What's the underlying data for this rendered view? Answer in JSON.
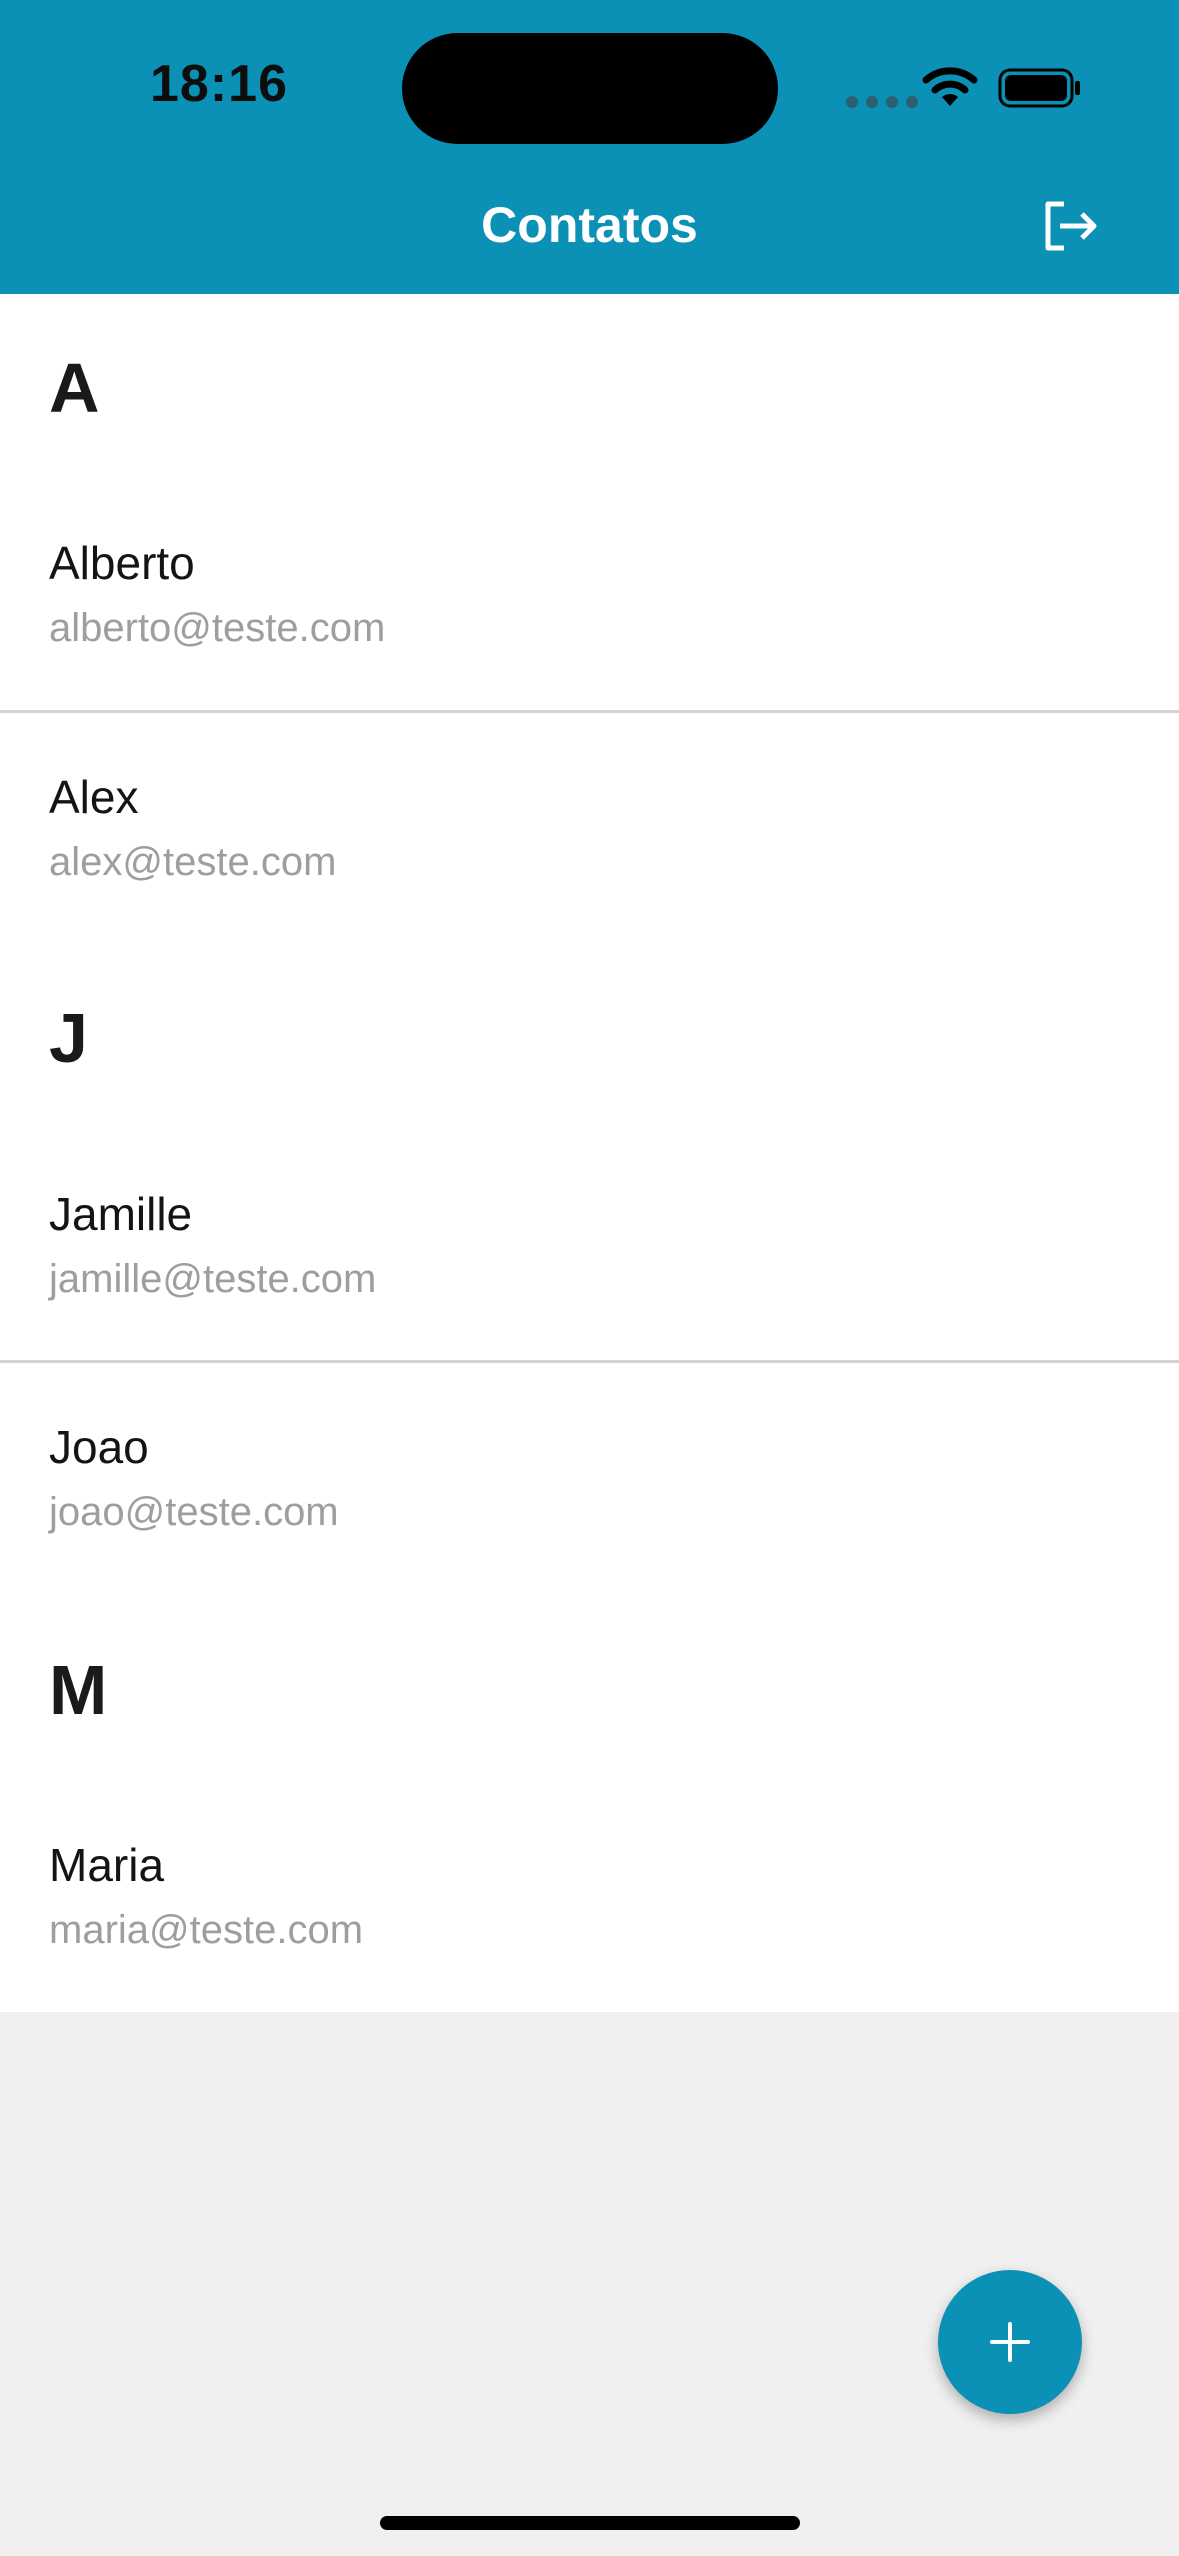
{
  "status_bar": {
    "time": "18:16"
  },
  "header": {
    "title": "Contatos",
    "logout_icon": "logout-icon"
  },
  "sections": [
    {
      "letter": "A",
      "contacts": [
        {
          "name": "Alberto",
          "email": "alberto@teste.com"
        },
        {
          "name": "Alex",
          "email": "alex@teste.com"
        }
      ]
    },
    {
      "letter": "J",
      "contacts": [
        {
          "name": "Jamille",
          "email": "jamille@teste.com"
        },
        {
          "name": "Joao",
          "email": "joao@teste.com"
        }
      ]
    },
    {
      "letter": "M",
      "contacts": [
        {
          "name": "Maria",
          "email": "maria@teste.com"
        }
      ]
    }
  ],
  "fab": {
    "icon": "plus-icon"
  },
  "colors": {
    "accent": "#0b90b6",
    "list_bg": "#ffffff",
    "page_bg": "#f0f0f0",
    "secondary_text": "#9e9e9e"
  }
}
